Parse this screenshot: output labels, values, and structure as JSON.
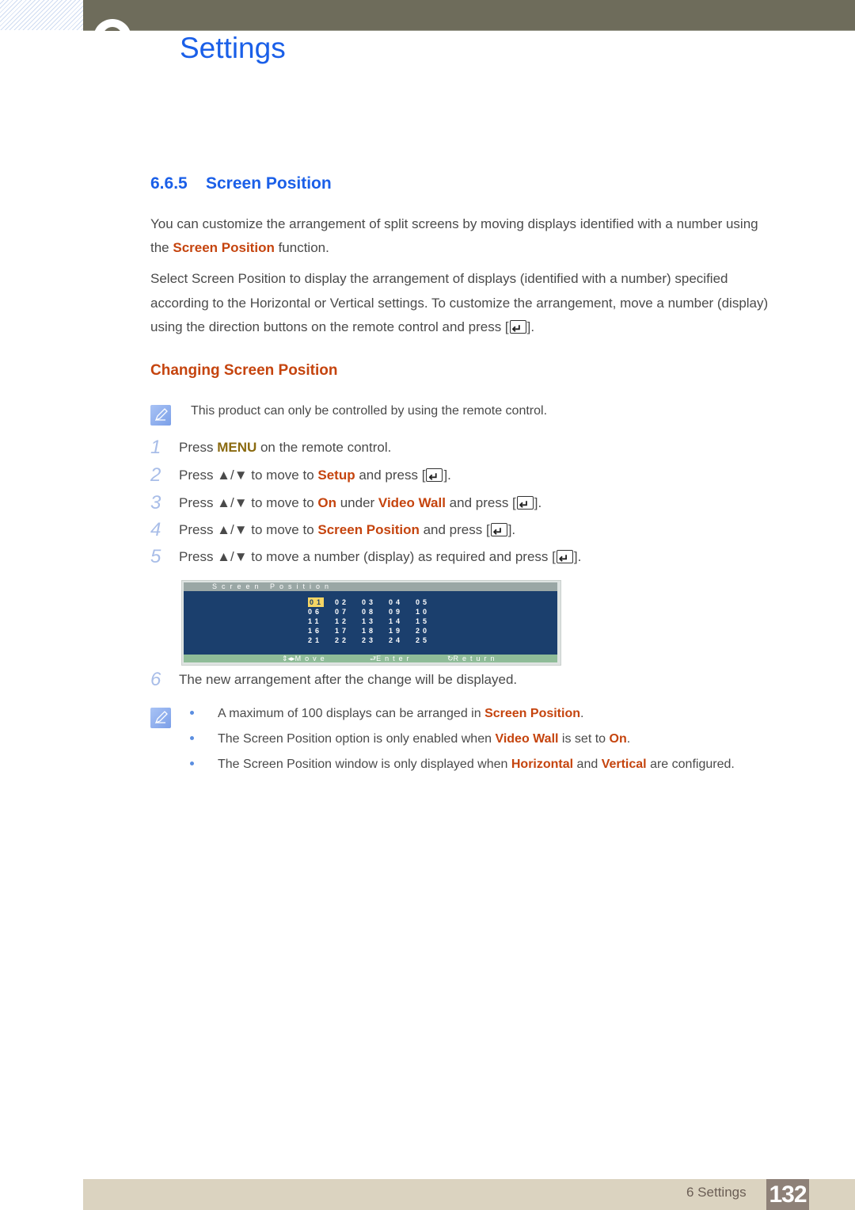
{
  "header": {
    "title": "Settings",
    "chapter_icon": "chapter-circle-icon"
  },
  "section": {
    "number": "6.6.5",
    "title": "Screen Position"
  },
  "intro": {
    "line1": "You can customize the arrangement of split screens by moving displays identified with a number using",
    "line2_pre": "the ",
    "line2_hl": "Screen Position",
    "line2_post": " function."
  },
  "description": {
    "line1": "Select Screen Position to display the arrangement of displays (identified with a number) specified",
    "line2": "according to the Horizontal or Vertical settings. To customize the arrangement, move a number (display)",
    "line3_pre": "using the direction buttons on the remote control and press [",
    "line3_post": "]."
  },
  "subheading": "Changing Screen Position",
  "note1": "This product can only be controlled by using the remote control.",
  "steps": [
    {
      "n": "1",
      "pre": "Press ",
      "hl": "MENU",
      "post": " on the remote control."
    },
    {
      "n": "2",
      "pre": "Press ▲/▼  to move to ",
      "hl": "Setup",
      "post": " and press [",
      "end": "]."
    },
    {
      "n": "3",
      "pre": "Press ▲/▼  to move to ",
      "hl": "On",
      "mid": " under ",
      "hl2": "Video Wall",
      "post": " and press [",
      "end": "]."
    },
    {
      "n": "4",
      "pre": "Press ▲/▼  to move to ",
      "hl": "Screen Position",
      "post": " and press [",
      "end": "]."
    },
    {
      "n": "5",
      "pre": "Press ▲/▼  to move a number (display) as required and press [",
      "end": "]."
    },
    {
      "n": "6",
      "pre": "The new arrangement after the change will be displayed."
    }
  ],
  "osd": {
    "title": "Screen Position",
    "grid": [
      [
        "01",
        "02",
        "03",
        "04",
        "05"
      ],
      [
        "06",
        "07",
        "08",
        "09",
        "10"
      ],
      [
        "11",
        "12",
        "13",
        "14",
        "15"
      ],
      [
        "16",
        "17",
        "18",
        "19",
        "20"
      ],
      [
        "21",
        "22",
        "23",
        "24",
        "25"
      ]
    ],
    "selected": "01",
    "footer": {
      "move": "Move",
      "enter": "Enter",
      "return": "Return"
    },
    "colors": {
      "body": "#1b3f6d",
      "selected": "#f5d564",
      "footer": "#8fbc98"
    }
  },
  "notes": [
    {
      "pre": "A maximum of 100 displays can be arranged in ",
      "hl": "Screen Position",
      "post": "."
    },
    {
      "pre": "The Screen Position option is only enabled when ",
      "hl": "Video Wall",
      "mid": " is set to ",
      "hl2": "On",
      "post": "."
    },
    {
      "pre": "The Screen Position window is only displayed when ",
      "hl": "Horizontal",
      "mid": " and ",
      "hl2": "Vertical",
      "post": " are configured."
    }
  ],
  "footer": {
    "chapter_label": "6 Settings",
    "page_number": "132"
  },
  "colors": {
    "heading_blue": "#1a5fe8",
    "highlight_orange": "#c5440e",
    "header_bar": "#6e6c5b",
    "footer_bar": "#dbd3c0",
    "page_badge": "#8e8178"
  }
}
